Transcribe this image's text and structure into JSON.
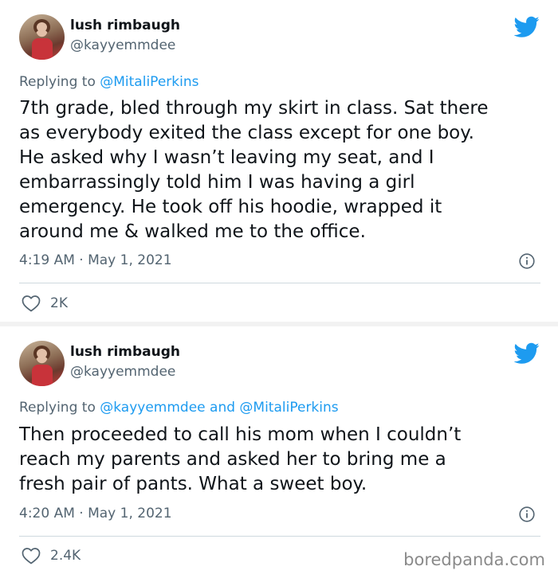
{
  "tweets": [
    {
      "display_name": "lush rimbaugh",
      "handle": "@kayyemmdee",
      "replying_prefix": "Replying to",
      "replying_to": "@MitaliPerkins",
      "text": "7th grade, bled through my skirt in class. Sat there\nas everybody exited the class except for one boy.\nHe asked why I wasn’t leaving my seat, and I\nembarrassingly told him I was having a girl\nemergency. He took off his hoodie, wrapped it\naround me & walked me to the office.",
      "timestamp": "4:19 AM · May 1, 2021",
      "likes": "2K"
    },
    {
      "display_name": "lush rimbaugh",
      "handle": "@kayyemmdee",
      "replying_prefix": "Replying to",
      "replying_to": "@kayyemmdee and @MitaliPerkins",
      "text": "Then proceeded to call his mom when I couldn’t\nreach my parents and asked her to bring me a\nfresh pair of pants. What a sweet boy.",
      "timestamp": "4:20 AM · May 1, 2021",
      "likes": "2.4K"
    }
  ],
  "watermark": "boredpanda.com",
  "colors": {
    "twitter_blue": "#1d9bf0",
    "secondary_text": "#536471",
    "primary_text": "#0f1419"
  },
  "icons": [
    "twitter-bird-icon",
    "info-icon",
    "heart-icon"
  ]
}
